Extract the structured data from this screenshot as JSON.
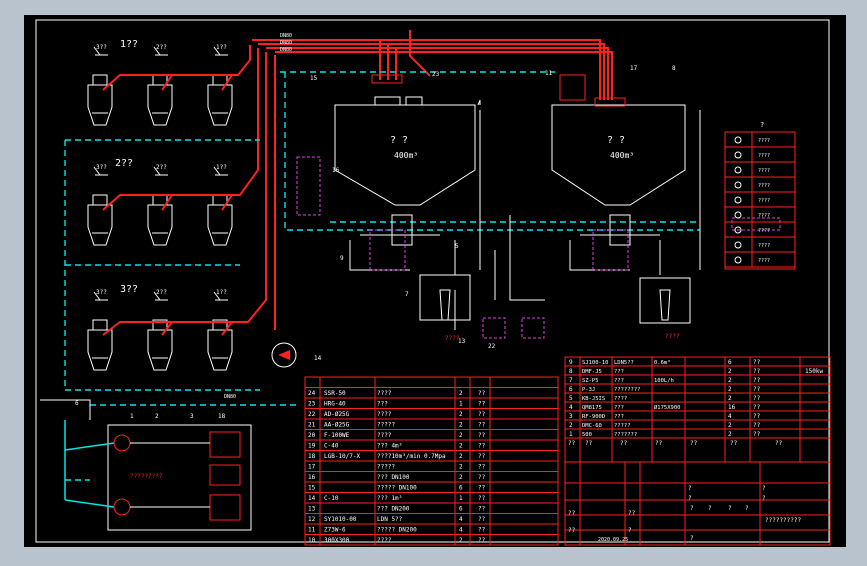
{
  "frame": {
    "bg": "#000000",
    "border": "#ffffff",
    "accent_red": "#ff2020",
    "cyan": "#00e5e5",
    "magenta": "#e040e0",
    "white": "#ffffff"
  },
  "groups": {
    "g1": "1??",
    "g2": "2??",
    "g3": "3??"
  },
  "unit_tags": [
    "3??",
    "2??",
    "1??"
  ],
  "pipe_labels": {
    "p1": "DN80",
    "p2": "DN80",
    "p3": "DN80",
    "main": "DN80",
    "vent": "DN80"
  },
  "silos": {
    "left": {
      "title": "? ?",
      "volume": "400m³"
    },
    "right": {
      "title": "? ?",
      "volume": "400m³"
    }
  },
  "callouts": [
    "23",
    "15",
    "16",
    "5",
    "7",
    "9",
    "17",
    "8",
    "14",
    "6",
    "18",
    "1",
    "2",
    "3",
    "22",
    "13",
    "11"
  ],
  "misc_labels": {
    "pump_box": "????",
    "feeder_label": "????",
    "right_feeder": "????",
    "box_left": "17",
    "box_right": "?",
    "panel_label": "?????????"
  },
  "legend": {
    "title": "?",
    "rows": [
      "????",
      "????",
      "????",
      "????",
      "????",
      "????",
      "????",
      "????",
      "????"
    ]
  },
  "bom_left": {
    "rows": [
      {
        "no": "24",
        "code": "SSR-50",
        "name": "????",
        "qty": "2",
        "note": "??"
      },
      {
        "no": "23",
        "code": "HRG-40",
        "name": "???",
        "qty": "1",
        "note": "??"
      },
      {
        "no": "22",
        "code": "AD-Ø25G",
        "name": "????",
        "qty": "2",
        "note": "??"
      },
      {
        "no": "21",
        "code": "AA-Ø25G",
        "name": "?????",
        "qty": "2",
        "note": "??"
      },
      {
        "no": "20",
        "code": "F-100WE",
        "name": "????",
        "qty": "2",
        "note": "??"
      },
      {
        "no": "19",
        "code": "C-40",
        "name": "??? 4m³",
        "qty": "2",
        "note": "??"
      },
      {
        "no": "18",
        "code": "LGB-10/7-X",
        "name": "????10m³/min 0.7Mpa",
        "qty": "2",
        "note": "??"
      },
      {
        "no": "17",
        "code": "",
        "name": "?????",
        "qty": "2",
        "note": "??"
      },
      {
        "no": "16",
        "code": "",
        "name": "??? DN100",
        "qty": "2",
        "note": "??"
      },
      {
        "no": "15",
        "code": "",
        "name": "????? DN100",
        "qty": "6",
        "note": "??"
      },
      {
        "no": "14",
        "code": "C-10",
        "name": "??? 1m³",
        "qty": "1",
        "note": "??"
      },
      {
        "no": "13",
        "code": "",
        "name": "??? DN200",
        "qty": "6",
        "note": "??"
      },
      {
        "no": "12",
        "code": "SY1010-00",
        "name": "LDN 5??",
        "qty": "4",
        "note": "??"
      },
      {
        "no": "11",
        "code": "Z73W-6",
        "name": "????? DN200",
        "qty": "4",
        "note": "??"
      },
      {
        "no": "10",
        "code": "300X300",
        "name": "????",
        "qty": "2",
        "note": "??"
      }
    ]
  },
  "bom_right": {
    "rows": [
      {
        "no": "9",
        "code": "SJ100-10",
        "name": "LDN5??",
        "spec": "0.6m³",
        "qty": "6",
        "note": "??"
      },
      {
        "no": "8",
        "code": "DMF-J5",
        "name": "???",
        "spec": "",
        "qty": "2",
        "note": "??"
      },
      {
        "no": "7",
        "code": "SZ-P5",
        "name": "???",
        "spec": "100L/h",
        "qty": "2",
        "note": "??"
      },
      {
        "no": "6",
        "code": "P-3J",
        "name": "????????",
        "spec": "",
        "qty": "2",
        "note": "??"
      },
      {
        "no": "5",
        "code": "KB-J5IS",
        "name": "????",
        "spec": "",
        "qty": "2",
        "note": "??"
      },
      {
        "no": "4",
        "code": "QM8175",
        "name": "???",
        "spec": "Ø175X900",
        "qty": "16",
        "note": "??"
      },
      {
        "no": "3",
        "code": "RF-900D",
        "name": "???",
        "spec": "",
        "qty": "4",
        "note": "??"
      },
      {
        "no": "2",
        "code": "DMC-60",
        "name": "?????",
        "spec": "",
        "qty": "2",
        "note": "??"
      },
      {
        "no": "1",
        "code": "500",
        "name": "???????",
        "spec": "",
        "qty": "2",
        "note": "??"
      }
    ],
    "header": [
      "??",
      "??",
      "??",
      "??",
      "??",
      "??",
      "??"
    ],
    "extra_note": "150kw"
  },
  "title_block": {
    "date": "2020.09.25",
    "main_title": "??????????",
    "cells": [
      "?",
      "?",
      "?",
      "?",
      "??",
      "??",
      "?",
      "?",
      "?",
      "?",
      "??",
      "?",
      "?"
    ]
  }
}
